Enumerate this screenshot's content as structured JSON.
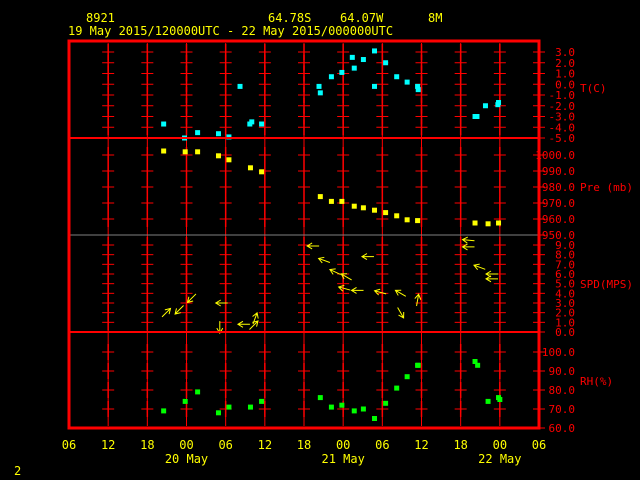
{
  "header": {
    "station": "8921",
    "lat": "64.78S",
    "lon": "64.07W",
    "elev": "8M",
    "period": "19 May 2015/120000UTC - 22 May 2015/000000UTC"
  },
  "page_number": "2",
  "colors": {
    "frame": "#ff0000",
    "text": "#ffff00",
    "temp": "#00ffff",
    "pres": "#ffff00",
    "wind": "#ffff00",
    "rh": "#00ff00",
    "divider": "#808080"
  },
  "chart_data": {
    "type": "scatter",
    "time_axis": {
      "range_hours": [
        0,
        72
      ],
      "tick_step_hours": 6,
      "tick_labels": [
        "06",
        "12",
        "18",
        "00",
        "06",
        "12",
        "18",
        "00",
        "06",
        "12",
        "18",
        "00",
        "06"
      ],
      "date_labels": [
        {
          "label": "20 May",
          "hour": 18
        },
        {
          "label": "21 May",
          "hour": 42
        },
        {
          "label": "22 May",
          "hour": 66
        }
      ]
    },
    "panels": [
      {
        "name": "temperature",
        "label": "T(C)",
        "ylim": [
          -5,
          3
        ],
        "ticks": [
          "3.0",
          "2.0",
          "1.0",
          "0.0",
          "-1.0",
          "-2.0",
          "-3.0",
          "-4.0",
          "-5.0"
        ],
        "points": [
          [
            14.5,
            -3.7
          ],
          [
            17.7,
            -5.0
          ],
          [
            19.7,
            -4.5
          ],
          [
            22.9,
            -4.6
          ],
          [
            24.5,
            -4.9
          ],
          [
            26.2,
            -0.2
          ],
          [
            27.7,
            -3.7
          ],
          [
            28.0,
            -3.5
          ],
          [
            29.5,
            -3.7
          ],
          [
            38.3,
            -0.2
          ],
          [
            38.5,
            -0.8
          ],
          [
            40.2,
            0.7
          ],
          [
            41.8,
            1.1
          ],
          [
            43.4,
            2.5
          ],
          [
            43.7,
            1.5
          ],
          [
            45.1,
            2.3
          ],
          [
            46.8,
            3.1
          ],
          [
            46.8,
            -0.2
          ],
          [
            48.5,
            2.0
          ],
          [
            50.2,
            0.7
          ],
          [
            51.8,
            0.2
          ],
          [
            53.4,
            -0.2
          ],
          [
            53.5,
            -0.5
          ],
          [
            62.2,
            -3.0
          ],
          [
            62.5,
            -3.0
          ],
          [
            63.8,
            -2.0
          ],
          [
            65.7,
            -1.9
          ],
          [
            65.8,
            -1.7
          ]
        ]
      },
      {
        "name": "pressure",
        "label": "Pre (mb)",
        "ylim": [
          950,
          1000
        ],
        "ticks": [
          "1000.0",
          "990.0",
          "980.0",
          "970.0",
          "960.0",
          "950.0"
        ],
        "points": [
          [
            14.5,
            1002.5
          ],
          [
            17.8,
            1002
          ],
          [
            19.7,
            1002
          ],
          [
            22.9,
            999.5
          ],
          [
            24.5,
            997
          ],
          [
            27.8,
            992
          ],
          [
            29.5,
            989.5
          ],
          [
            38.5,
            974
          ],
          [
            40.2,
            971
          ],
          [
            41.8,
            971
          ],
          [
            43.7,
            968
          ],
          [
            45.1,
            967
          ],
          [
            46.8,
            965.5
          ],
          [
            48.5,
            964
          ],
          [
            50.2,
            962
          ],
          [
            51.8,
            959.5
          ],
          [
            53.4,
            959
          ],
          [
            62.2,
            957.5
          ],
          [
            64.2,
            957
          ],
          [
            65.8,
            957.5
          ]
        ]
      },
      {
        "name": "wind",
        "label": "SPD(MPS)",
        "ylim": [
          0,
          9
        ],
        "ticks": [
          "9.0",
          "8.0",
          "7.0",
          "6.0",
          "5.0",
          "4.0",
          "3.0",
          "2.0",
          "1.0",
          "0.0"
        ],
        "points": [
          [
            14.9,
            2.0,
            45
          ],
          [
            16.9,
            2.3,
            225
          ],
          [
            18.8,
            3.5,
            225
          ],
          [
            23.4,
            3.0,
            270
          ],
          [
            23.1,
            0.5,
            180
          ],
          [
            26.8,
            0.8,
            270
          ],
          [
            28.3,
            0.7,
            45
          ],
          [
            28.5,
            1.4,
            20
          ],
          [
            37.4,
            8.9,
            270
          ],
          [
            39.1,
            7.4,
            290
          ],
          [
            40.8,
            6.2,
            295
          ],
          [
            42.5,
            5.7,
            300
          ],
          [
            42.2,
            4.5,
            285
          ],
          [
            44.2,
            4.3,
            270
          ],
          [
            45.8,
            7.8,
            270
          ],
          [
            47.7,
            4.1,
            285
          ],
          [
            50.8,
            4.0,
            300
          ],
          [
            50.8,
            2.0,
            150
          ],
          [
            53.4,
            3.3,
            10
          ],
          [
            61.2,
            9.5,
            275
          ],
          [
            61.2,
            8.8,
            270
          ],
          [
            62.9,
            6.7,
            290
          ],
          [
            64.8,
            6.0,
            270
          ],
          [
            64.8,
            5.5,
            270
          ]
        ]
      },
      {
        "name": "humidity",
        "label": "RH(%)",
        "ylim": [
          60,
          100
        ],
        "ticks": [
          "100.0",
          "90.0",
          "80.0",
          "70.0",
          "60.0"
        ],
        "points": [
          [
            14.5,
            69
          ],
          [
            17.8,
            74
          ],
          [
            19.7,
            79
          ],
          [
            22.9,
            68
          ],
          [
            24.5,
            71
          ],
          [
            27.8,
            71
          ],
          [
            29.5,
            74
          ],
          [
            38.5,
            76
          ],
          [
            40.2,
            71
          ],
          [
            41.8,
            72
          ],
          [
            43.7,
            69
          ],
          [
            45.1,
            70
          ],
          [
            46.8,
            65
          ],
          [
            48.5,
            73
          ],
          [
            50.2,
            81
          ],
          [
            51.8,
            87
          ],
          [
            53.4,
            93
          ],
          [
            53.5,
            93
          ],
          [
            62.2,
            95
          ],
          [
            62.6,
            93
          ],
          [
            64.2,
            74
          ],
          [
            65.8,
            76
          ],
          [
            66.0,
            75
          ]
        ]
      }
    ]
  }
}
